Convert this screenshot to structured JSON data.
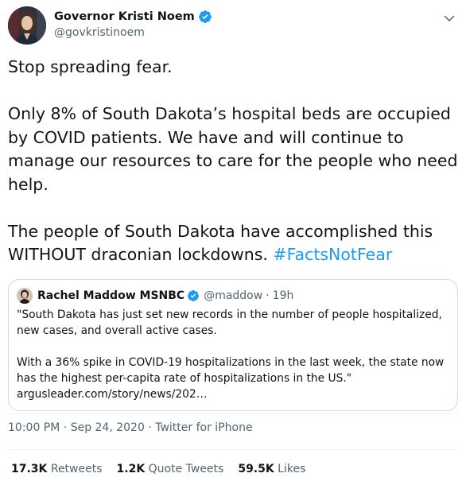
{
  "author": {
    "display_name": "Governor Kristi Noem",
    "handle": "@govkristinoem"
  },
  "icons": {
    "verified": "verified-badge-icon",
    "more": "chevron-down-icon",
    "verified_color": "#1d9bf0"
  },
  "tweet": {
    "line1": "Stop spreading fear.",
    "line2": "Only 8% of South Dakota’s hospital beds are occupied by COVID patients. We have and will continue to manage our resources to care for the people who need help.",
    "line3": "The people of South Dakota have accomplished this WITHOUT draconian lockdowns. ",
    "hashtag": "#FactsNotFear"
  },
  "quote": {
    "display_name": "Rachel Maddow MSNBC",
    "handle": "@maddow",
    "separator": "·",
    "time": "19h",
    "text": "\"South Dakota has just set new records in the number of people hospitalized, new cases, and overall active cases.\n\nWith a 36% spike in COVID-19 hospitalizations in the last week, the state now has the highest per-capita rate of hospitalizations in the US.\"\nargusleader.com/story/news/202…"
  },
  "meta": {
    "time": "10:00 PM",
    "sep1": " · ",
    "date": "Sep 24, 2020",
    "sep2": " · ",
    "source": "Twitter for iPhone"
  },
  "stats": {
    "retweets_count": "17.3K",
    "retweets_label": " Retweets",
    "quotes_count": "1.2K",
    "quotes_label": " Quote Tweets",
    "likes_count": "59.5K",
    "likes_label": " Likes"
  }
}
